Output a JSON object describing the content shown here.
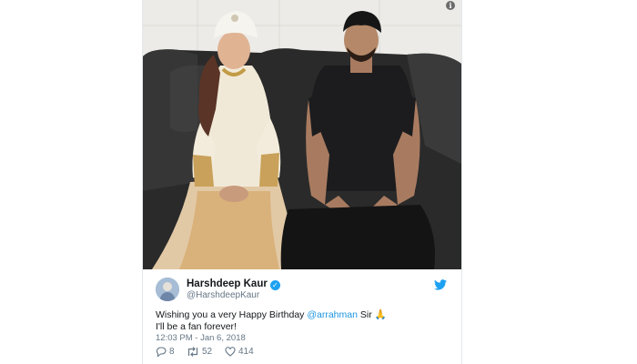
{
  "tweet": {
    "display_name": "Harshdeep Kaur",
    "handle": "@HarshdeepKaur",
    "text_pre": "Wishing you a very Happy Birthday ",
    "mention": "@arrahman",
    "text_post": " Sir",
    "emoji": "🙏",
    "text_line2": "I'll be a fan forever!",
    "timestamp": "12:03 PM - Jan 6, 2018",
    "replies": "8",
    "retweets": "52",
    "likes": "414"
  },
  "icons": {
    "info": "info-icon",
    "verified": "verified-badge-icon",
    "twitter": "twitter-bird-icon",
    "reply": "reply-icon",
    "retweet": "retweet-icon",
    "like": "heart-icon"
  },
  "colors": {
    "twitter_blue": "#1da1f2",
    "mention": "#1b95e0",
    "meta_text": "#657786",
    "like_green": "#17bf63"
  }
}
